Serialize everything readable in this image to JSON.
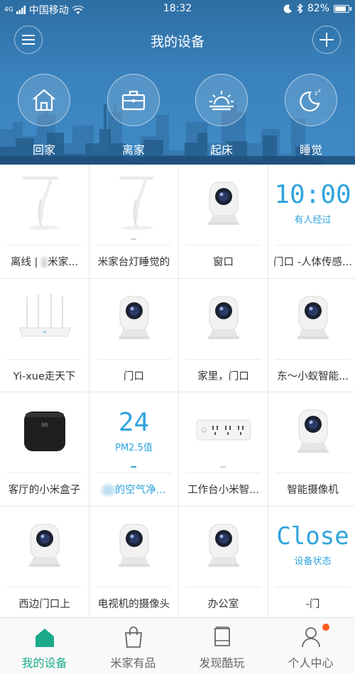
{
  "status_bar": {
    "signal": "4G",
    "carrier": "中国移动",
    "time": "18:32",
    "battery": "82%",
    "battery_level": 0.82
  },
  "header": {
    "title": "我的设备"
  },
  "scenes": [
    {
      "label": "回家",
      "icon": "home-icon"
    },
    {
      "label": "离家",
      "icon": "briefcase-icon"
    },
    {
      "label": "起床",
      "icon": "sunrise-icon"
    },
    {
      "label": "睡觉",
      "icon": "moon-sleep-icon"
    }
  ],
  "devices": [
    {
      "name_pre": "离线 | ",
      "name_blur": "··",
      "name_post": "米家...",
      "visual": "desk-lamp"
    },
    {
      "name": "米家台灯睡觉的",
      "visual": "desk-lamp"
    },
    {
      "name": "窗口",
      "visual": "camera"
    },
    {
      "name": "门口 -人体传感...",
      "visual": "sensor",
      "big": "10:00",
      "sub": "有人经过"
    },
    {
      "name": "Yi-xue走天下",
      "visual": "router"
    },
    {
      "name": "门口",
      "visual": "camera"
    },
    {
      "name": "家里，门口",
      "visual": "camera"
    },
    {
      "name": "东～小蚁智能...",
      "visual": "camera"
    },
    {
      "name": "客厅的小米盒子",
      "visual": "mi-box",
      "logo": "MI"
    },
    {
      "name_blur": "····",
      "name_post": "的空气净...",
      "visual": "air-purifier",
      "big": "24",
      "sub": "PM2.5值"
    },
    {
      "name": "工作台小米智...",
      "visual": "power-strip"
    },
    {
      "name": "智能摄像机",
      "visual": "camera"
    },
    {
      "name": "西边门口上",
      "visual": "camera"
    },
    {
      "name": "电视机的摄像头",
      "visual": "camera"
    },
    {
      "name": "办公室",
      "visual": "camera"
    },
    {
      "name": "-门",
      "visual": "door-sensor",
      "big": "Close",
      "sub": "设备状态"
    }
  ],
  "tabs": [
    {
      "label": "我的设备",
      "icon": "home-tab-icon",
      "active": true
    },
    {
      "label": "米家有品",
      "icon": "shopping-bag-icon"
    },
    {
      "label": "发现酷玩",
      "icon": "discover-icon"
    },
    {
      "label": "个人中心",
      "icon": "person-icon"
    }
  ],
  "colors": {
    "header_blue": "#3a82bd",
    "accent_teal": "#1aaa8a",
    "value_blue": "#2fa4dd",
    "notification": "#ff5a1f"
  }
}
